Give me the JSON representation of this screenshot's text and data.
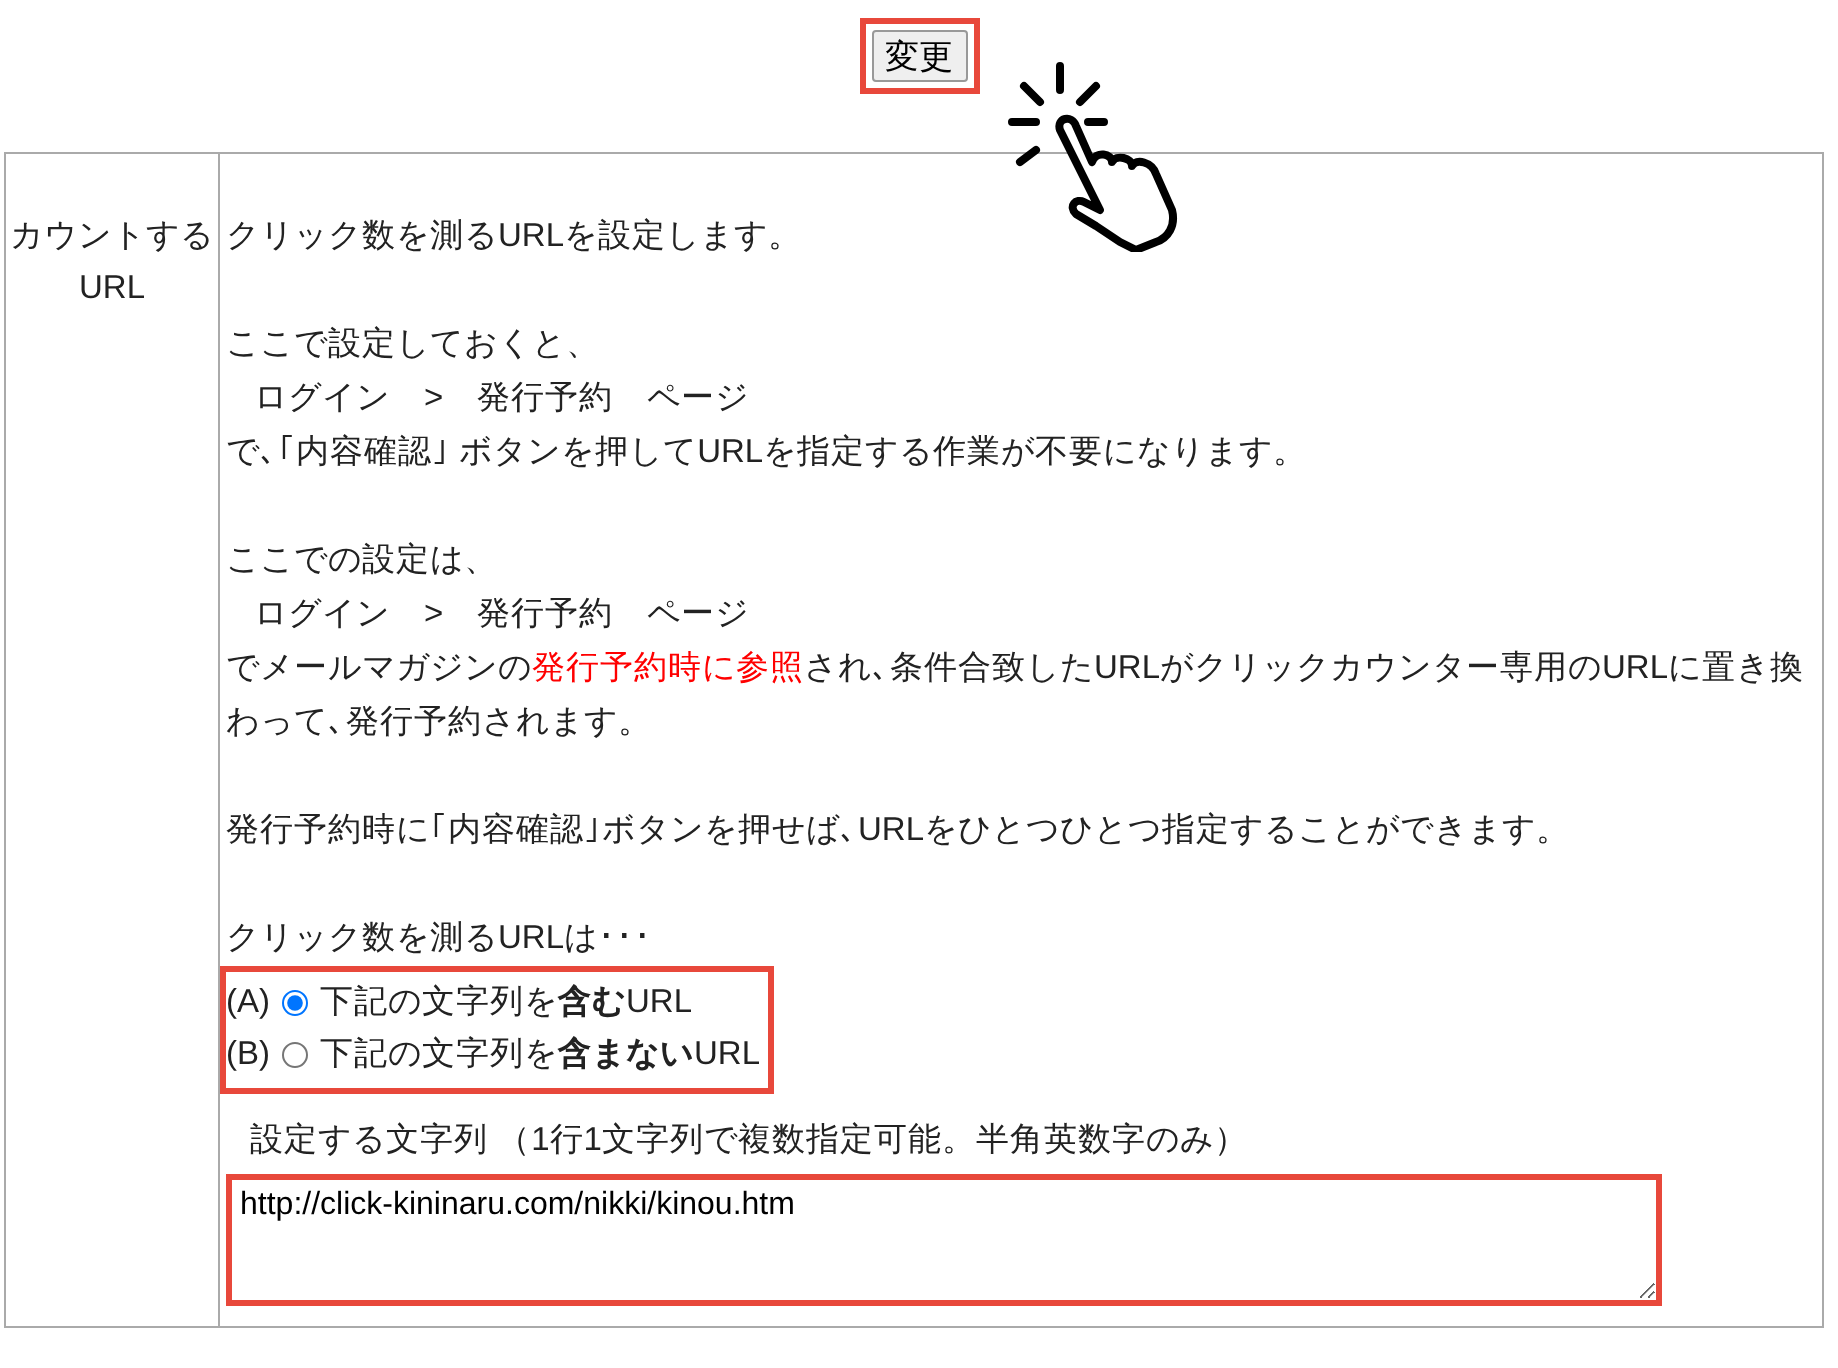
{
  "submit_button": {
    "label": "変更",
    "highlighted": true
  },
  "setting_row": {
    "label_lines": [
      "カウントする",
      "URL"
    ],
    "paragraphs": [
      {
        "lines": [
          {
            "kind": "text",
            "text": "クリック数を測るURLを設定します。"
          }
        ]
      },
      {
        "lines": [
          {
            "kind": "text",
            "text": "ここで設定しておくと、"
          },
          {
            "kind": "path",
            "text": "ログイン　>　発行予約　ページ"
          },
          {
            "kind": "text",
            "text": "で､｢内容確認｣ ボタンを押してURLを指定する作業が不要になります。"
          }
        ]
      },
      {
        "lines": [
          {
            "kind": "text",
            "text": "ここでの設定は、"
          },
          {
            "kind": "path",
            "text": "ログイン　>　発行予約　ページ"
          },
          {
            "kind": "mixed",
            "parts": [
              {
                "text": "でメールマガジンの",
                "emphasis": false
              },
              {
                "text": "発行予約時に参照",
                "emphasis": true
              },
              {
                "text": "され､条件合致したURLがクリックカウンター専用のURLに置き換わって､発行予約されます。",
                "emphasis": false
              }
            ]
          }
        ]
      },
      {
        "lines": [
          {
            "kind": "text",
            "text": "発行予約時に｢内容確認｣ボタンを押せば､URLをひとつひとつ指定することができます。"
          }
        ]
      }
    ],
    "choice_intro": "クリック数を測るURLは･･･",
    "choices_highlighted": true,
    "choices": [
      {
        "prefix": "(A)",
        "label": "下記の文字列を**含む**URL",
        "selected": true
      },
      {
        "prefix": "(B)",
        "label": "下記の文字列を**含まない**URL",
        "selected": false
      }
    ],
    "pattern_field": {
      "label": "設定する文字列 （1行1文字列で複数指定可能。半角英数字のみ）",
      "value": "http://click-kininaru.com/nikki/kinou.htm",
      "highlighted": true
    }
  }
}
